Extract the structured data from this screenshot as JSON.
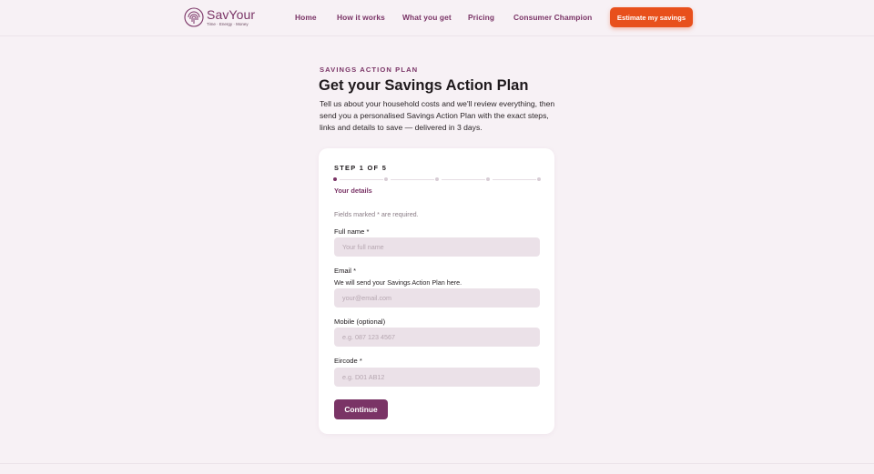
{
  "brand": {
    "name": "SavYour",
    "tagline": "Time · Energy · Money",
    "colors": {
      "primary": "#7a3466",
      "accent": "#e8501c",
      "background": "#f7f1f5"
    }
  },
  "nav": {
    "items": [
      "Home",
      "How it works",
      "What you get",
      "Pricing",
      "Consumer Champion"
    ],
    "cta_label": "Estimate my savings"
  },
  "intro": {
    "eyebrow": "SAVINGS ACTION PLAN",
    "title": "Get your Savings Action Plan",
    "lede": "Tell us about your household costs and we'll review everything, then send you a personalised Savings Action Plan with the exact steps, links and details to save — delivered in 3 days."
  },
  "form": {
    "step_label": "STEP 1 OF 5",
    "progress": {
      "current": 1,
      "total": 5
    },
    "step_name": "Your details",
    "required_note": "Fields marked * are required.",
    "fields": [
      {
        "label": "Full name *",
        "help": "",
        "value": "",
        "placeholder": "Your full name"
      },
      {
        "label": "Email *",
        "help": "We will send your Savings Action Plan here.",
        "value": "",
        "placeholder": "your@email.com"
      },
      {
        "label": "Mobile (optional)",
        "help": "",
        "value": "",
        "placeholder": "e.g. 087 123 4567"
      },
      {
        "label": "Eircode *",
        "help": "",
        "value": "",
        "placeholder": "e.g. D01 AB12"
      }
    ],
    "continue_label": "Continue"
  }
}
